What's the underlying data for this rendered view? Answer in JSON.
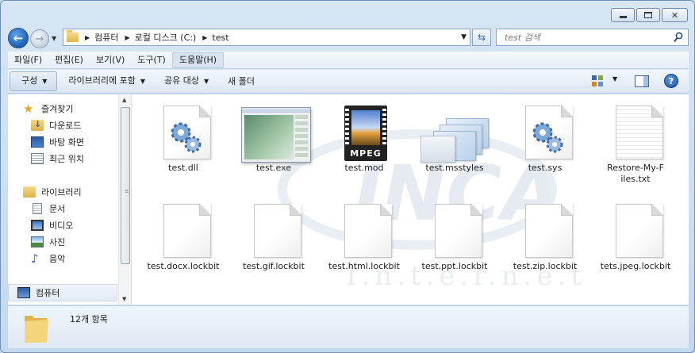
{
  "window": {
    "caption_buttons": {
      "minimize": "minimize",
      "maximize": "maximize",
      "close": "✕"
    }
  },
  "address": {
    "breadcrumbs": [
      "컴퓨터",
      "로컬 디스크 (C:)",
      "test"
    ]
  },
  "search": {
    "placeholder": "test 검색"
  },
  "menu": [
    "파일(F)",
    "편집(E)",
    "보기(V)",
    "도구(T)",
    "도움말(H)"
  ],
  "toolbar": {
    "organize": "구성",
    "library": "라이브러리에 포함",
    "share": "공유 대상",
    "new_folder": "새 폴더",
    "help": "?"
  },
  "nav": {
    "favorites": "즐겨찾기",
    "downloads": "다운로드",
    "desktop": "바탕 화면",
    "recent": "최근 위치",
    "libraries": "라이브러리",
    "documents": "문서",
    "videos": "비디오",
    "pictures": "사진",
    "music": "음악",
    "computer": "컴퓨터"
  },
  "files": [
    {
      "name": "test.dll",
      "icon": "gear-file"
    },
    {
      "name": "test.exe",
      "icon": "exe-window"
    },
    {
      "name": "test.mod",
      "icon": "mpeg-video"
    },
    {
      "name": "test.msstyles",
      "icon": "msstyles"
    },
    {
      "name": "test.sys",
      "icon": "gear-file"
    },
    {
      "name": "Restore-My-Files.txt",
      "icon": "text-file"
    },
    {
      "name": "test.docx.lockbit",
      "icon": "blank-file"
    },
    {
      "name": "test.gif.lockbit",
      "icon": "blank-file"
    },
    {
      "name": "test.html.lockbit",
      "icon": "blank-file"
    },
    {
      "name": "test.ppt.lockbit",
      "icon": "blank-file"
    },
    {
      "name": "test.zip.lockbit",
      "icon": "blank-file"
    },
    {
      "name": "tets.jpeg.lockbit",
      "icon": "blank-file"
    }
  ],
  "mpeg_label": "MPEG",
  "watermark": {
    "logo": "INCA",
    "subtitle": "I.n.t.e.r.n.e.t"
  },
  "status": {
    "item_count": "12개 항목"
  }
}
